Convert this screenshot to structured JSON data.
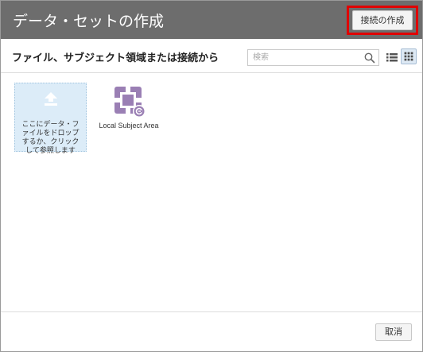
{
  "dialog": {
    "title": "データ・セットの作成",
    "create_connection_label": "接続の作成",
    "subtitle": "ファイル、サブジェクト領域または接続から",
    "search": {
      "placeholder": "検索",
      "value": ""
    },
    "view_modes": [
      {
        "icon": "list-view-icon",
        "selected": false
      },
      {
        "icon": "grid-view-icon",
        "selected": true
      }
    ],
    "dropzone": {
      "icon": "upload-icon",
      "lines": [
        "ここにデータ・フ",
        "ァイルをドロップ",
        "するか、クリック",
        "して参照します"
      ]
    },
    "sources": [
      {
        "label": "Local Subject Area",
        "icon": "subject-area-icon",
        "color": "#9a7fb4"
      }
    ],
    "cancel_label": "取消"
  },
  "colors": {
    "titlebar": "#6d6d6d",
    "highlight": "#e00000",
    "dropzone_bg": "#dcecf8",
    "subject_area_accent": "#9a7fb4"
  }
}
